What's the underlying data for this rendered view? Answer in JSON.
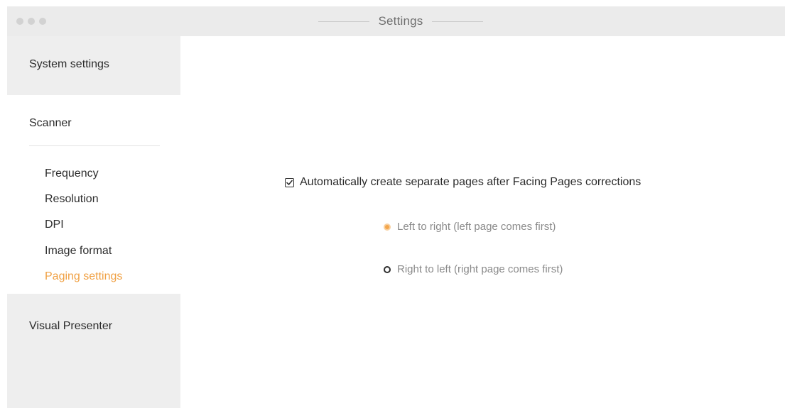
{
  "window": {
    "title": "Settings"
  },
  "sidebar": {
    "system_settings": "System settings",
    "scanner": "Scanner",
    "scanner_items": [
      {
        "label": "Frequency"
      },
      {
        "label": "Resolution"
      },
      {
        "label": "DPI"
      },
      {
        "label": "Image format"
      },
      {
        "label": "Paging settings"
      }
    ],
    "active_item": "Paging settings",
    "visual_presenter": "Visual Presenter"
  },
  "paging": {
    "auto_separate_label": "Automatically create separate pages after Facing Pages corrections",
    "auto_separate_checked": true,
    "options": [
      {
        "label": "Left to right (left page comes first)",
        "selected": true
      },
      {
        "label": "Right to left (right page comes first)",
        "selected": false
      }
    ]
  },
  "colors": {
    "accent": "#f0a144",
    "sidebar_bg": "#eeeeee",
    "titlebar_bg": "#ebebeb"
  }
}
